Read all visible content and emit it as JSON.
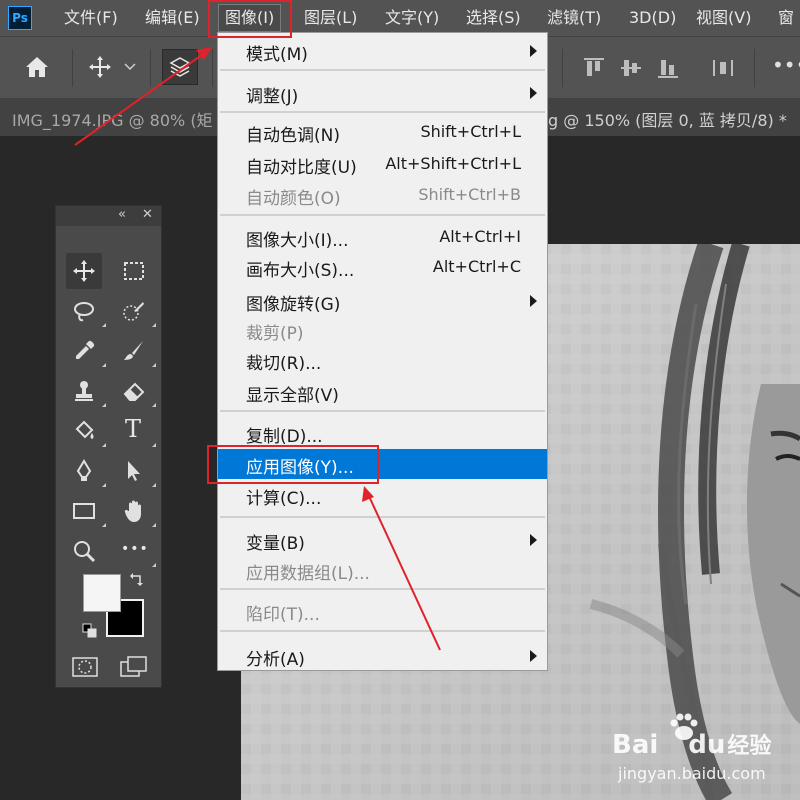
{
  "app": {
    "logo": "Ps"
  },
  "menubar": {
    "items": [
      "文件(F)",
      "编辑(E)",
      "图像(I)",
      "图层(L)",
      "文字(Y)",
      "选择(S)",
      "滤镜(T)",
      "3D(D)",
      "视图(V)",
      "窗"
    ]
  },
  "optionsbar": {
    "icons": [
      "home-icon",
      "move-icon",
      "chevron-down-icon",
      "layers-select-icon",
      "align-top-icon",
      "align-vcenter-icon",
      "align-bottom-icon",
      "distribute-icon",
      "more-icon"
    ]
  },
  "tabs": {
    "left": "IMG_1974.JPG @ 80% (矩",
    "right": "g @ 150% (图层 0, 蓝 拷贝/8) *"
  },
  "tools_panel": {
    "collapse": "«",
    "close": "✕",
    "tools": [
      "move-tool",
      "marquee-tool",
      "lasso-tool",
      "quick-select-tool",
      "eyedropper-tool",
      "brush-tool",
      "stamp-tool",
      "eraser-tool",
      "paint-bucket-tool",
      "type-tool",
      "pen-tool",
      "path-select-tool",
      "rectangle-tool",
      "hand-tool",
      "zoom-tool",
      "more-tools"
    ],
    "type_glyph": "T",
    "more_glyph": "•••",
    "foreground_color": "#f5f5f5",
    "background_color": "#000000"
  },
  "image_menu": {
    "items": [
      {
        "label": "模式(M)",
        "shortcut": "",
        "submenu": true,
        "disabled": false
      },
      {
        "label": "调整(J)",
        "shortcut": "",
        "submenu": true,
        "disabled": false
      },
      {
        "label": "自动色调(N)",
        "shortcut": "Shift+Ctrl+L",
        "submenu": false,
        "disabled": false
      },
      {
        "label": "自动对比度(U)",
        "shortcut": "Alt+Shift+Ctrl+L",
        "submenu": false,
        "disabled": false
      },
      {
        "label": "自动颜色(O)",
        "shortcut": "Shift+Ctrl+B",
        "submenu": false,
        "disabled": true
      },
      {
        "label": "图像大小(I)...",
        "shortcut": "Alt+Ctrl+I",
        "submenu": false,
        "disabled": false
      },
      {
        "label": "画布大小(S)...",
        "shortcut": "Alt+Ctrl+C",
        "submenu": false,
        "disabled": false
      },
      {
        "label": "图像旋转(G)",
        "shortcut": "",
        "submenu": true,
        "disabled": false
      },
      {
        "label": "裁剪(P)",
        "shortcut": "",
        "submenu": false,
        "disabled": true
      },
      {
        "label": "裁切(R)...",
        "shortcut": "",
        "submenu": false,
        "disabled": false
      },
      {
        "label": "显示全部(V)",
        "shortcut": "",
        "submenu": false,
        "disabled": false
      },
      {
        "label": "复制(D)...",
        "shortcut": "",
        "submenu": false,
        "disabled": false
      },
      {
        "label": "应用图像(Y)...",
        "shortcut": "",
        "submenu": false,
        "disabled": false,
        "highlighted": true
      },
      {
        "label": "计算(C)...",
        "shortcut": "",
        "submenu": false,
        "disabled": false
      },
      {
        "label": "变量(B)",
        "shortcut": "",
        "submenu": true,
        "disabled": false
      },
      {
        "label": "应用数据组(L)...",
        "shortcut": "",
        "submenu": false,
        "disabled": true
      },
      {
        "label": "陷印(T)...",
        "shortcut": "",
        "submenu": false,
        "disabled": true
      },
      {
        "label": "分析(A)",
        "shortcut": "",
        "submenu": true,
        "disabled": false
      }
    ]
  },
  "colors": {
    "accent": "#0078d7",
    "annotation": "#e0222a"
  },
  "watermark": {
    "brand": "Bai",
    "brand2": "du",
    "product": "经验",
    "url": "jingyan.baidu.com"
  }
}
